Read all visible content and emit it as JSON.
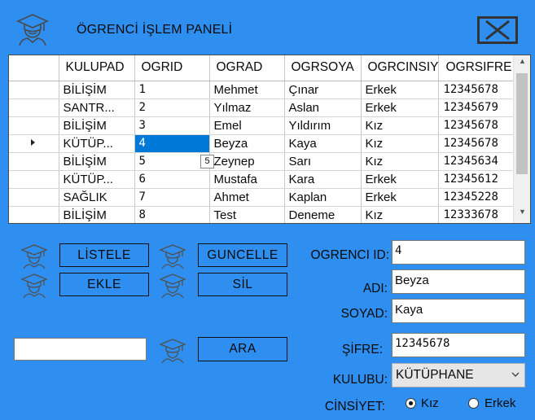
{
  "window": {
    "title": "ÖGRENCİ İŞLEM PANELİ"
  },
  "grid": {
    "columns": [
      "KULUPAD",
      "OGRID",
      "OGRAD",
      "OGRSOYA",
      "OGRCINSIY",
      "OGRSIFRE"
    ],
    "rows": [
      [
        "BİLİŞİM",
        "1",
        "Mehmet",
        "Çınar",
        "Erkek",
        "12345678"
      ],
      [
        "SANTR...",
        "2",
        "Yılmaz",
        "Aslan",
        "Erkek",
        "12345679"
      ],
      [
        "BİLİŞİM",
        "3",
        "Emel",
        "Yıldırım",
        "Kız",
        "12345678"
      ],
      [
        "KÜTÜP...",
        "4",
        "Beyza",
        "Kaya",
        "Kız",
        "12345678"
      ],
      [
        "BİLİŞİM",
        "5",
        "Zeynep",
        "Sarı",
        "Kız",
        "12345634"
      ],
      [
        "KÜTÜP...",
        "6",
        "Mustafa",
        "Kara",
        "Erkek",
        "12345612"
      ],
      [
        "SAĞLIK",
        "7",
        "Ahmet",
        "Kaplan",
        "Erkek",
        "12345228"
      ],
      [
        "BİLİŞİM",
        "8",
        "Test",
        "Deneme",
        "Kız",
        "12333678"
      ]
    ],
    "tooltip": "5"
  },
  "buttons": {
    "listele": "LİSTELE",
    "guncelle": "GUNCELLE",
    "ekle": "EKLE",
    "sil": "SİL",
    "ara": "ARA"
  },
  "search": {
    "value": ""
  },
  "form": {
    "id_label": "OGRENCI ID:",
    "id_value": "4",
    "ad_label": "ADI:",
    "ad_value": "Beyza",
    "soyad_label": "SOYAD:",
    "soyad_value": "Kaya",
    "sifre_label": "ŞİFRE:",
    "sifre_value": "12345678",
    "kulup_label": "KULUBU:",
    "kulup_value": "KÜTÜPHANE",
    "cinsiyet_label": "CİNSİYET:",
    "kiz_label": "Kız",
    "erkek_label": "Erkek"
  },
  "icons": {
    "header": "graduate-icon",
    "button": "graduation-cap-icon",
    "close": "close-icon"
  },
  "colors": {
    "background": "#2f8ff0",
    "selection": "#0078d7"
  }
}
